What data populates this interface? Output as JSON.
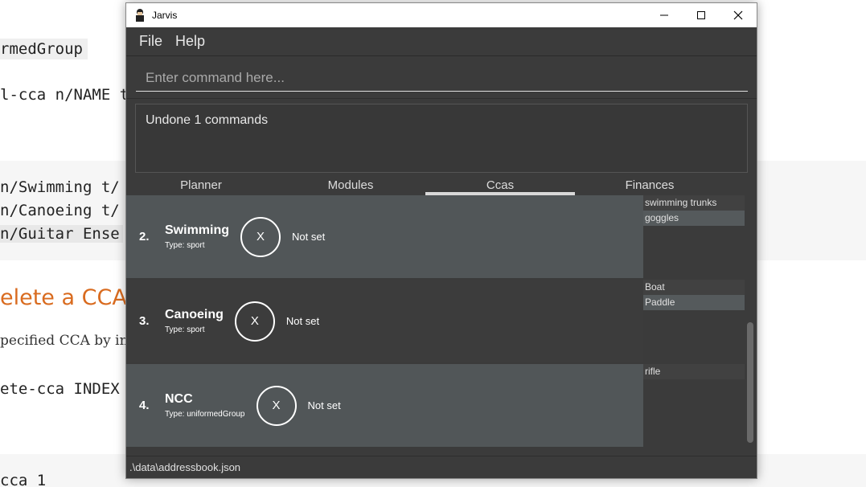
{
  "background_doc": {
    "line1": "rmedGroup",
    "line2": "l-cca n/NAME t/",
    "code_lines": [
      " n/Swimming t/",
      " n/Canoeing t/",
      " n/Guitar Ense"
    ],
    "heading": "elete a CCA:",
    "desc": "pecified CCA by in",
    "cmd": "ete-cca INDEX",
    "example": "cca 1"
  },
  "window": {
    "title": "Jarvis",
    "icon": "jarvis-butler-icon",
    "controls": [
      "minimize-icon",
      "maximize-icon",
      "close-icon"
    ]
  },
  "menu": [
    "File",
    "Help"
  ],
  "command": {
    "placeholder": "Enter command here...",
    "value": ""
  },
  "result": {
    "text": "Undone 1 commands"
  },
  "tabs": [
    {
      "label": "Planner",
      "active": false
    },
    {
      "label": "Modules",
      "active": false
    },
    {
      "label": "Ccas",
      "active": true
    },
    {
      "label": "Finances",
      "active": false
    }
  ],
  "ccas": [
    {
      "index": "2.",
      "name": "Swimming",
      "type": "Type: sport",
      "progress": "X",
      "status": "Not set",
      "equipment": [
        "swimming trunks",
        "goggles"
      ]
    },
    {
      "index": "3.",
      "name": "Canoeing",
      "type": "Type: sport",
      "progress": "X",
      "status": "Not set",
      "equipment": [
        "Boat",
        "Paddle"
      ]
    },
    {
      "index": "4.",
      "name": "NCC",
      "type": "Type: uniformedGroup",
      "progress": "X",
      "status": "Not set",
      "equipment": [
        "rifle"
      ]
    }
  ],
  "status_bar": {
    "path": ".\\data\\addressbook.json"
  },
  "colors": {
    "window_bg": "#3b3b3b",
    "row_odd": "#515658",
    "row_even": "#3c3c3c",
    "doc_heading": "#d96b1f"
  }
}
